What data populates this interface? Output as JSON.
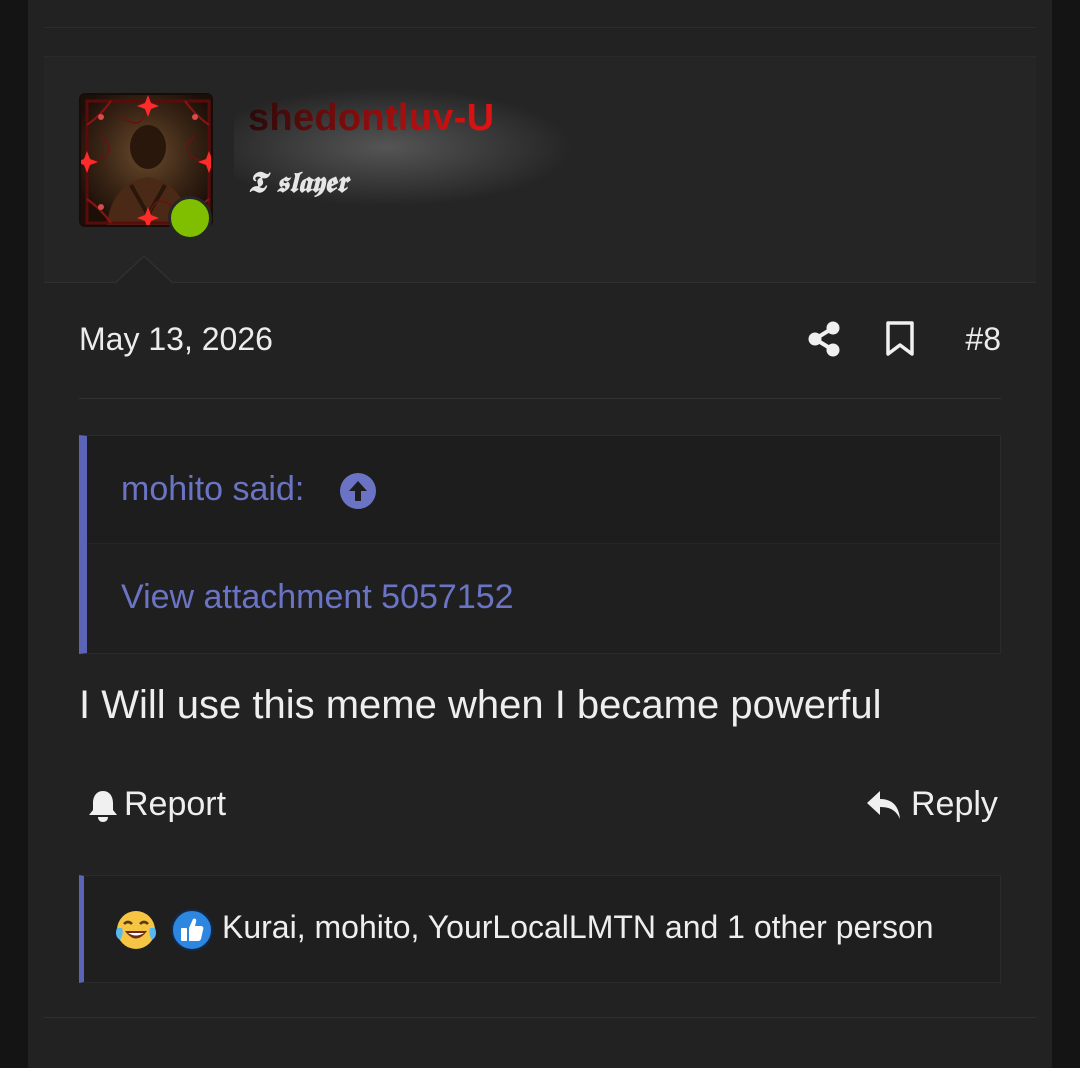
{
  "user": {
    "username": "shedontluv-U",
    "title": "𝕿 𝖘𝖑𝖆𝖞𝖊𝖗",
    "online": true,
    "username_gradient": [
      "#2a0a0a",
      "#d01010"
    ]
  },
  "meta": {
    "date": "May 13, 2026",
    "share_icon": "share-icon",
    "bookmark_icon": "bookmark-icon",
    "post_number": "#8"
  },
  "quote": {
    "author": "mohito said:",
    "jump_icon": "arrow-up-circle-icon",
    "body": "View attachment 5057152",
    "accent": "#5b64b6"
  },
  "post": {
    "body": "I Will use this meme when I became powerful"
  },
  "actions": {
    "report_label": "Report",
    "report_icon": "bell-icon",
    "reply_label": "Reply",
    "reply_icon": "reply-arrow-icon"
  },
  "reactions": {
    "icons": [
      "laughing-crying-emoji-icon",
      "thumbs-up-icon"
    ],
    "summary": "Kurai, mohito, YourLocalLMTN and 1 other person"
  }
}
